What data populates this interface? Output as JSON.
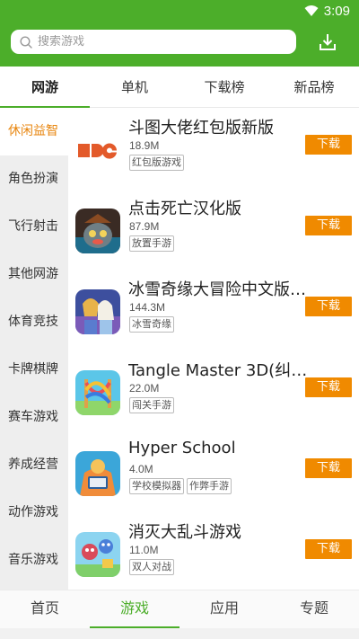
{
  "status_bar": {
    "time": "3:09",
    "wifi_icon": "wifi-icon"
  },
  "search": {
    "placeholder": "搜索游戏",
    "icon": "search-icon"
  },
  "header": {
    "download_icon": "download-icon"
  },
  "colors": {
    "brand": "#4cae2a",
    "accent": "#f08a00",
    "active_sidebar": "#e8860f"
  },
  "top_tabs": [
    {
      "label": "网游",
      "active": true
    },
    {
      "label": "单机",
      "active": false
    },
    {
      "label": "下载榜",
      "active": false
    },
    {
      "label": "新品榜",
      "active": false
    }
  ],
  "sidebar": {
    "items": [
      {
        "label": "休闲益智",
        "active": true
      },
      {
        "label": "角色扮演",
        "active": false
      },
      {
        "label": "飞行射击",
        "active": false
      },
      {
        "label": "其他网游",
        "active": false
      },
      {
        "label": "体育竞技",
        "active": false
      },
      {
        "label": "卡牌棋牌",
        "active": false
      },
      {
        "label": "赛车游戏",
        "active": false
      },
      {
        "label": "养成经营",
        "active": false
      },
      {
        "label": "动作游戏",
        "active": false
      },
      {
        "label": "音乐游戏",
        "active": false
      }
    ]
  },
  "games": [
    {
      "title": "斗图大佬红包版新版",
      "size": "18.9M",
      "tags": [
        "红包版游戏"
      ],
      "download_label": "下载"
    },
    {
      "title": "点击死亡汉化版",
      "size": "87.9M",
      "tags": [
        "放置手游"
      ],
      "download_label": "下载"
    },
    {
      "title": "冰雪奇缘大冒险中文版…",
      "size": "144.3M",
      "tags": [
        "冰雪奇缘"
      ],
      "download_label": "下载"
    },
    {
      "title": "Tangle Master 3D(纠结…",
      "size": "22.0M",
      "tags": [
        "闯关手游"
      ],
      "download_label": "下载"
    },
    {
      "title": "Hyper School",
      "size": "4.0M",
      "tags": [
        "学校模拟器",
        "作弊手游"
      ],
      "download_label": "下载"
    },
    {
      "title": "消灭大乱斗游戏",
      "size": "11.0M",
      "tags": [
        "双人对战"
      ],
      "download_label": "下载"
    }
  ],
  "bottom_nav": [
    {
      "label": "首页",
      "active": false
    },
    {
      "label": "游戏",
      "active": true
    },
    {
      "label": "应用",
      "active": false
    },
    {
      "label": "专题",
      "active": false
    }
  ]
}
